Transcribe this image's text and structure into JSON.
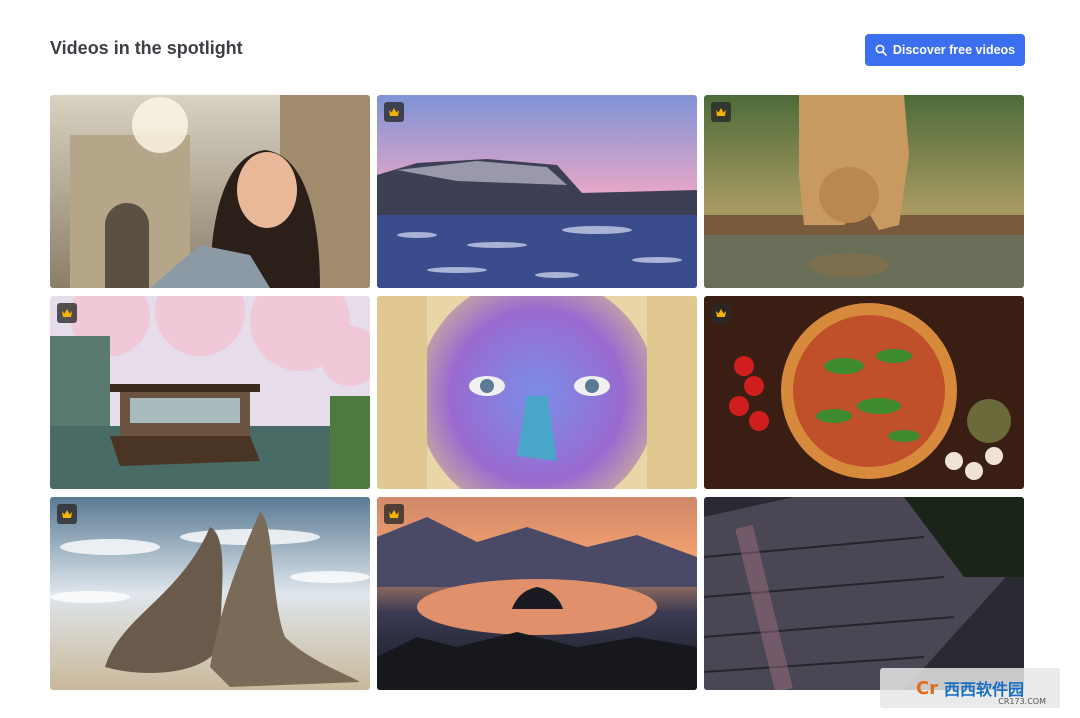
{
  "section": {
    "title": "Videos in the spotlight",
    "discover_label": "Discover free videos"
  },
  "videos": [
    {
      "subject": "woman selfie in old town",
      "premium": false
    },
    {
      "subject": "frozen lake with mountain at dusk",
      "premium": true
    },
    {
      "subject": "lioness drinking from water",
      "premium": true
    },
    {
      "subject": "cherry blossom canal with boat",
      "premium": true
    },
    {
      "subject": "face covered in colorful powder",
      "premium": false
    },
    {
      "subject": "pizza on wooden board",
      "premium": true
    },
    {
      "subject": "elephant seals on beach",
      "premium": true
    },
    {
      "subject": "lake with island at sunset",
      "premium": true
    },
    {
      "subject": "wet cobblestone path",
      "premium": false
    }
  ],
  "colors": {
    "accent": "#3b6ff0",
    "badge": "#f4b400"
  },
  "watermark": {
    "brand": "西西软件园",
    "url": "CR173.COM"
  }
}
